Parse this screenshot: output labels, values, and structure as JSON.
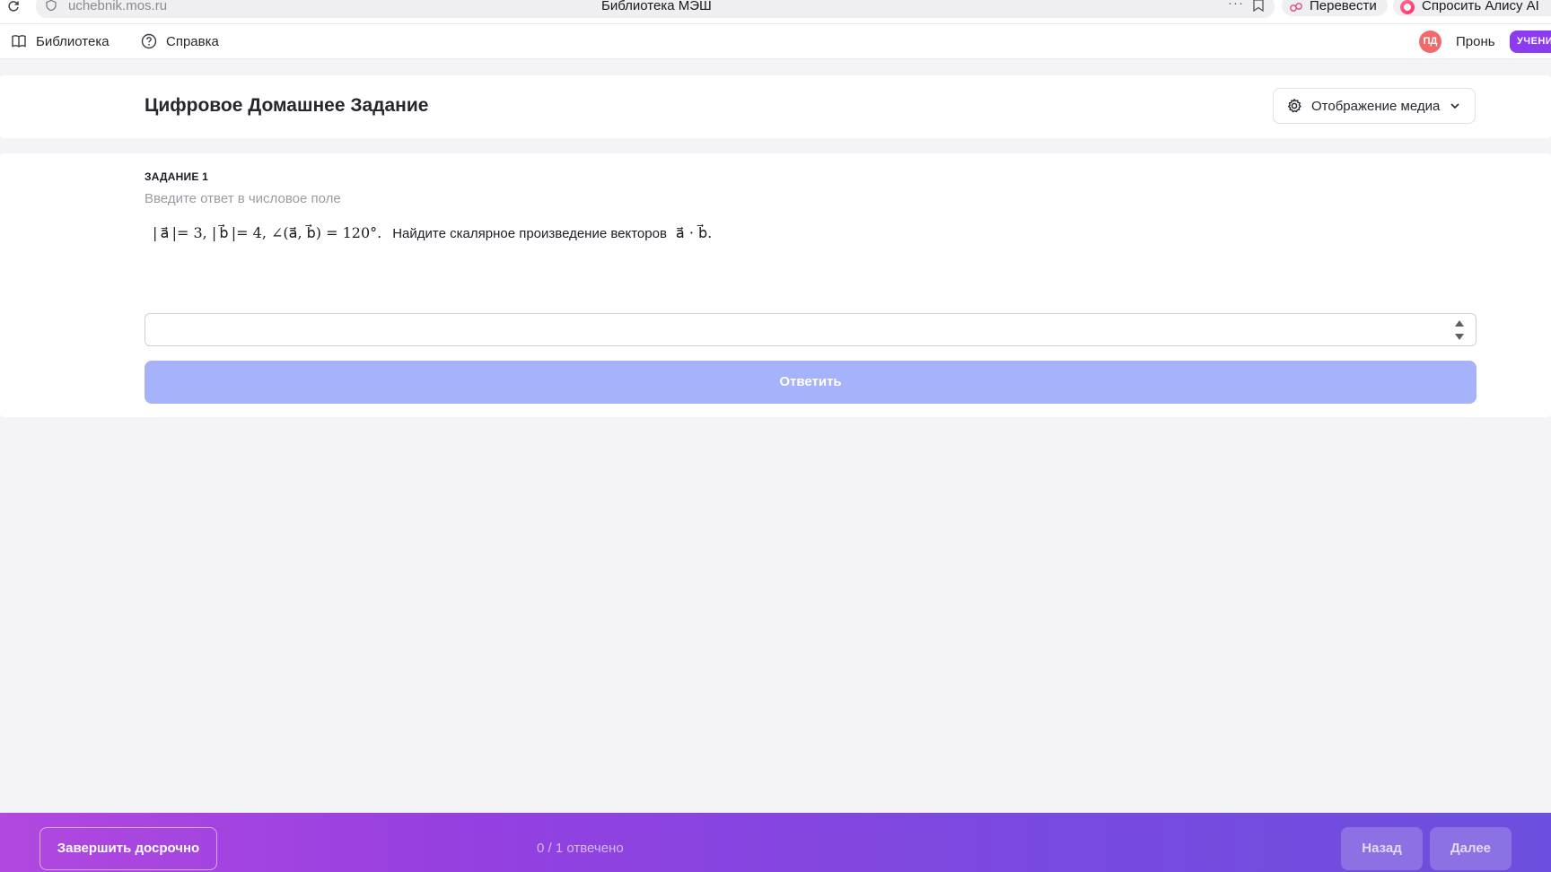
{
  "browser": {
    "url": "uchebnik.mos.ru",
    "page_title": "Библиотека МЭШ",
    "translate_label": "Перевести",
    "alice_label": "Спросить Алису AI",
    "more_dots": "···"
  },
  "nav": {
    "library_label": "Библиотека",
    "help_label": "Справка",
    "avatar_initials": "ПД",
    "user_name": "Пронь",
    "role_badge": "УЧЕНИ"
  },
  "header": {
    "title": "Цифровое Домашнее Задание",
    "media_button_label": "Отображение медиа"
  },
  "task": {
    "number_label": "ЗАДАНИЕ 1",
    "hint": "Введите ответ в числовое поле",
    "statement_text": "Найдите скалярное произведение векторов",
    "answer_value": "",
    "submit_label": "Ответить"
  },
  "footer": {
    "finish_label": "Завершить досрочно",
    "progress_text": "0 / 1 отвечено",
    "back_label": "Назад",
    "next_label": "Далее"
  },
  "colors": {
    "accent_purple": "#8b3cf0",
    "submit_disabled": "#a6b3fa",
    "footer_gradient_start": "#b148df",
    "footer_gradient_end": "#6c4fde",
    "avatar": "#f06a6a"
  },
  "icons": {
    "reload": "reload-icon",
    "shield": "shield-icon",
    "bookmark": "bookmark-icon",
    "translate": "translate-icon",
    "alice": "alice-icon",
    "library": "book-icon",
    "help": "question-circle-icon",
    "media": "gear-icon",
    "dropdown": "chevron-down-icon",
    "stepper": "stepper-arrows-icon"
  }
}
